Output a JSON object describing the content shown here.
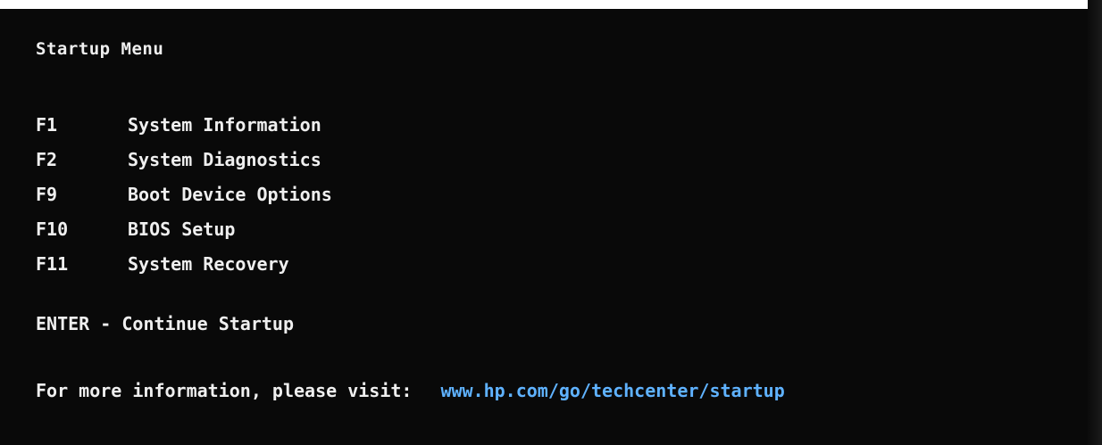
{
  "startup_menu": {
    "title": "Startup Menu",
    "items": [
      {
        "key": "F1",
        "label": "System Information"
      },
      {
        "key": "F2",
        "label": "System Diagnostics"
      },
      {
        "key": "F9",
        "label": "Boot Device Options"
      },
      {
        "key": "F10",
        "label": "BIOS Setup"
      },
      {
        "key": "F11",
        "label": "System Recovery"
      }
    ],
    "enter": {
      "key": "ENTER",
      "separator": "-",
      "label": "Continue Startup"
    },
    "info": {
      "text": "For more information, please visit:",
      "url": "www.hp.com/go/techcenter/startup"
    }
  },
  "colors": {
    "background": "#090909",
    "text": "#efefef",
    "link": "#5fb2ff"
  }
}
